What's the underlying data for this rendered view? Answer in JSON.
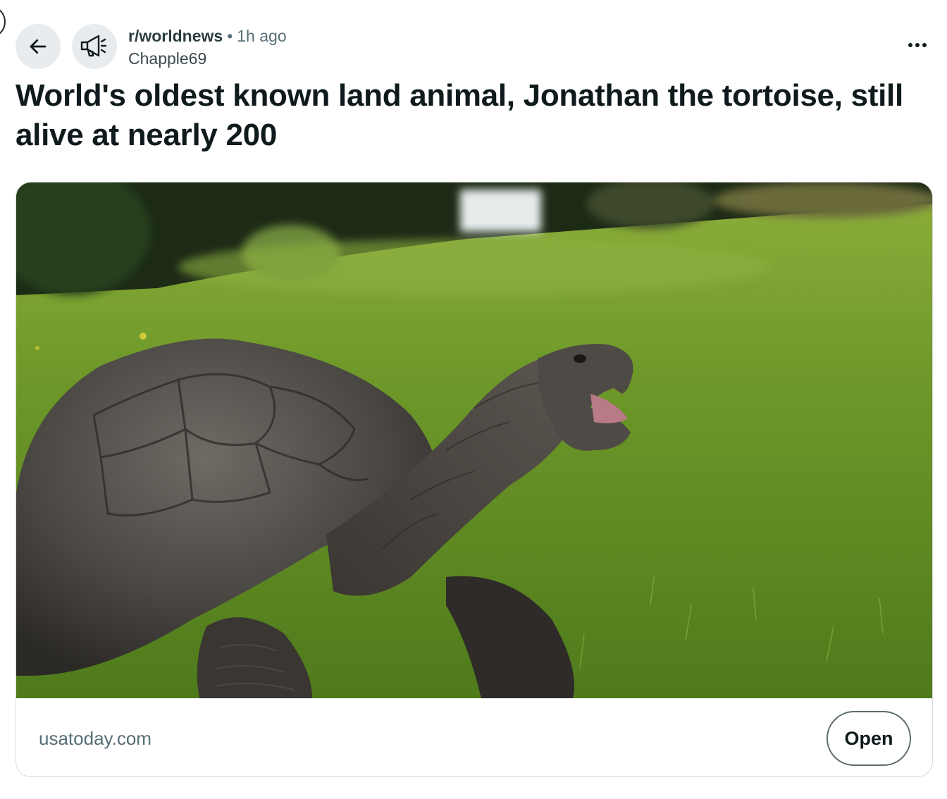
{
  "post": {
    "subreddit": "r/worldnews",
    "separator": "•",
    "time_ago": "1h ago",
    "author": "Chapple69",
    "title": "World's oldest known land animal, Jonathan the tortoise, still alive at nearly 200"
  },
  "link_card": {
    "domain": "usatoday.com",
    "open_label": "Open",
    "image_subject": "giant tortoise with raised head on green grass"
  },
  "icons": {
    "back": "arrow-left-icon",
    "subreddit_avatar": "megaphone-icon",
    "more": "more-horizontal-icon"
  },
  "colors": {
    "text_primary": "#0f1a1c",
    "text_secondary": "#576f76",
    "button_bg": "#e9ecee",
    "card_border": "#d6dadc"
  }
}
